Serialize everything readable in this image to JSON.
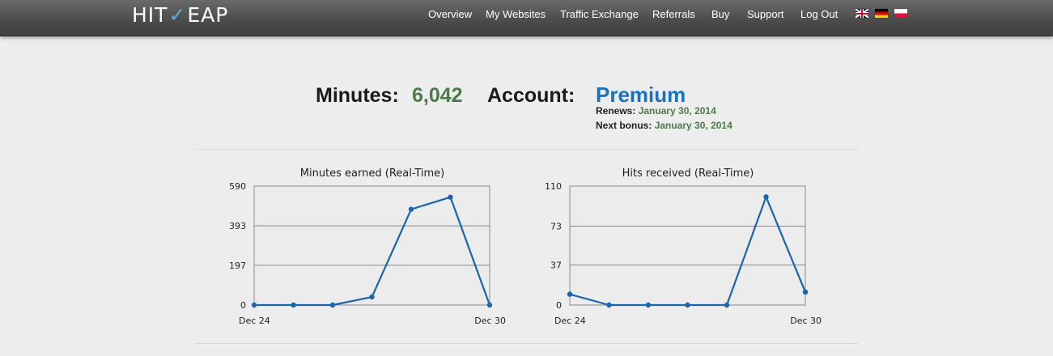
{
  "header": {
    "logo_left": "HIT",
    "logo_check": "✓",
    "logo_right": "EAP",
    "nav": [
      "Overview",
      "My Websites",
      "Traffic Exchange",
      "Referrals",
      "Buy",
      "Support",
      "Log Out"
    ],
    "flags": [
      "uk-flag-icon",
      "germany-flag-icon",
      "poland-flag-icon"
    ]
  },
  "stats": {
    "minutes_label": "Minutes:",
    "minutes_value": "6,042",
    "account_label": "Account:",
    "account_value": "Premium",
    "renews_label": "Renews:",
    "renews_value": "January 30, 2014",
    "bonus_label": "Next bonus:",
    "bonus_value": "January 30, 2014"
  },
  "colors": {
    "accent_green": "#4a7b49",
    "accent_blue": "#1a70c1",
    "line": "#1a64b0"
  },
  "chart_data": [
    {
      "type": "line",
      "title": "Minutes earned (Real-Time)",
      "x": [
        "Dec 24",
        "Dec 25",
        "Dec 26",
        "Dec 27",
        "Dec 28",
        "Dec 29",
        "Dec 30"
      ],
      "values": [
        0,
        0,
        0,
        40,
        475,
        535,
        0
      ],
      "ylim": [
        0,
        590
      ],
      "yticks": [
        "0",
        "197",
        "393",
        "590"
      ],
      "xticks": [
        "Dec 24",
        "Dec 30"
      ],
      "grid": true
    },
    {
      "type": "line",
      "title": "Hits received (Real-Time)",
      "x": [
        "Dec 24",
        "Dec 25",
        "Dec 26",
        "Dec 27",
        "Dec 28",
        "Dec 29",
        "Dec 30"
      ],
      "values": [
        10,
        0,
        0,
        0,
        0,
        100,
        12
      ],
      "ylim": [
        0,
        110
      ],
      "yticks": [
        "0",
        "37",
        "73",
        "110"
      ],
      "xticks": [
        "Dec 24",
        "Dec 30"
      ],
      "grid": true
    }
  ]
}
